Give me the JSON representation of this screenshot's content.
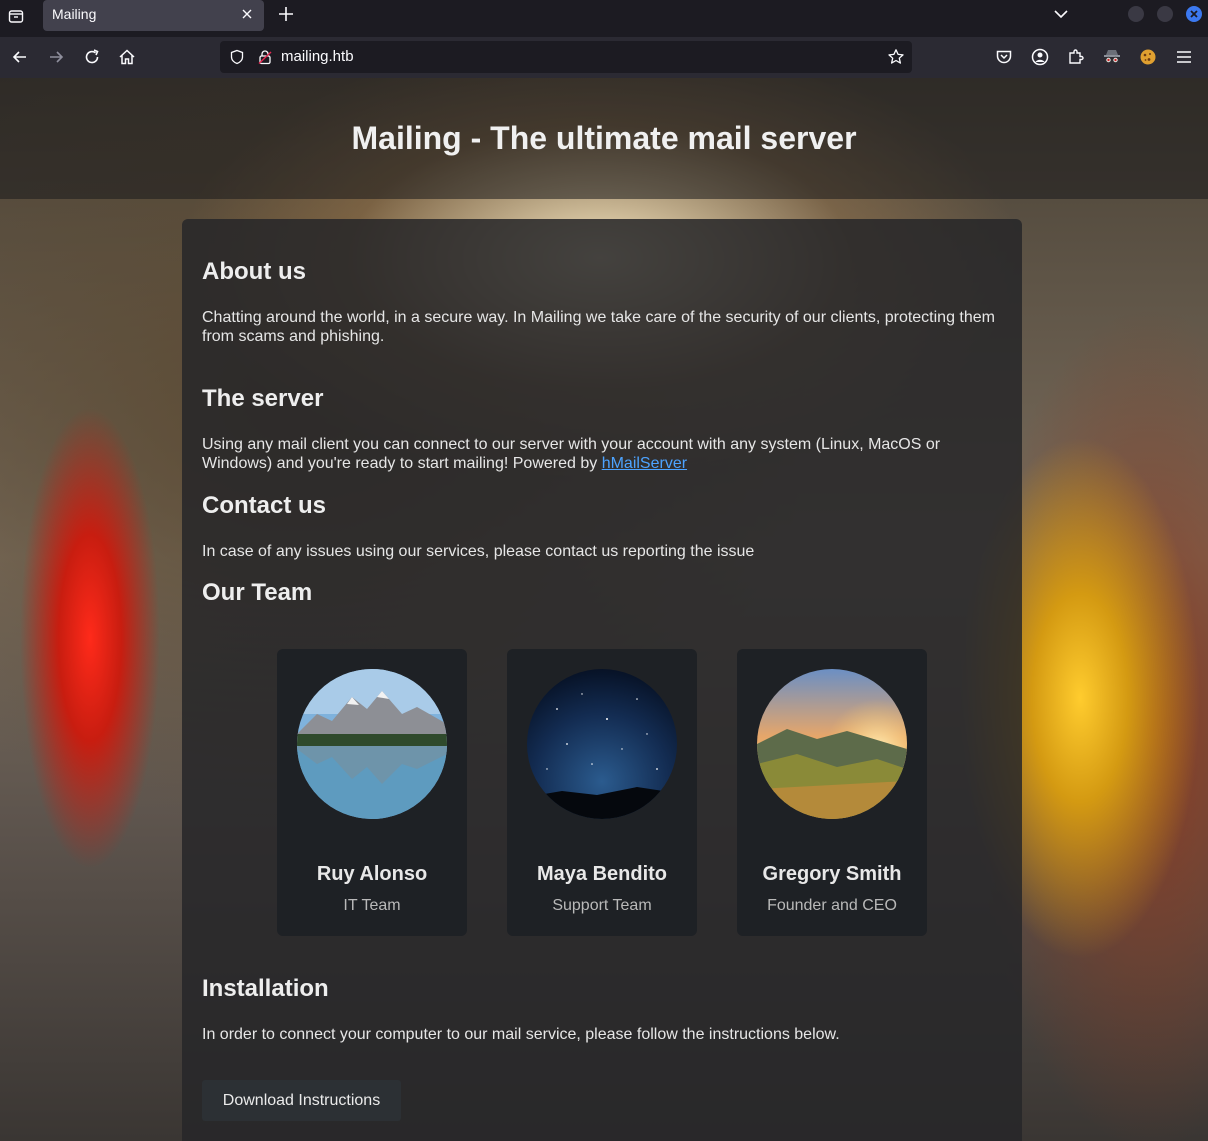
{
  "browser": {
    "tab": {
      "title": "Mailing"
    },
    "address_bar": {
      "url": "mailing.htb"
    }
  },
  "page": {
    "hero_title": "Mailing - The ultimate mail server",
    "sections": {
      "about": {
        "heading": "About us",
        "text": "Chatting around the world, in a secure way. In Mailing we take care of the security of our clients, protecting them from scams and phishing."
      },
      "server": {
        "heading": "The server",
        "text": "Using any mail client you can connect to our server with your account with any system (Linux, MacOS or Windows) and you're ready to start mailing! Powered by ",
        "link_text": "hMailServer"
      },
      "contact": {
        "heading": "Contact us",
        "text": "In case of any issues using our services, please contact us reporting the issue"
      },
      "team": {
        "heading": "Our Team",
        "members": [
          {
            "name": "Ruy Alonso",
            "role": "IT Team",
            "avatar": "mountain-lake-photo"
          },
          {
            "name": "Maya Bendito",
            "role": "Support Team",
            "avatar": "starry-night-photo"
          },
          {
            "name": "Gregory Smith",
            "role": "Founder and CEO",
            "avatar": "sunset-hills-photo"
          }
        ]
      },
      "installation": {
        "heading": "Installation",
        "text": "In order to connect your computer to our mail service, please follow the instructions below.",
        "button_label": "Download Instructions"
      }
    }
  },
  "colors": {
    "link": "#4da3ff",
    "panel": "#262629",
    "card": "#1e2125",
    "browser_chrome": "#1c1b22"
  }
}
